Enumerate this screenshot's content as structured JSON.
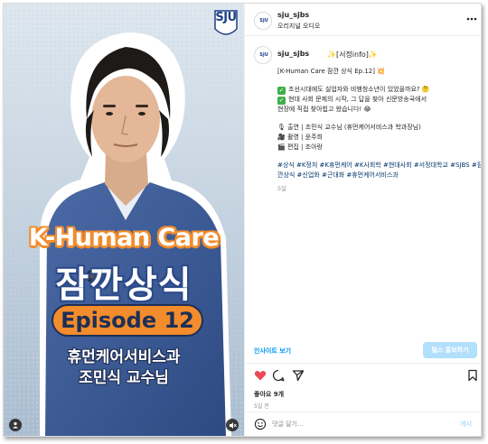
{
  "media": {
    "brand_logo": "SJU",
    "title_en": "K-Human Care",
    "title_ko": "잠깐상식",
    "episode": "Episode 12",
    "subtitle_1": "휴먼케어서비스과",
    "subtitle_2": "조민식 교수님",
    "icons": {
      "tagged_user": "user-tag-icon",
      "audio": "mute-icon"
    }
  },
  "header": {
    "username": "sju_sjbs",
    "subtitle": "오리지널 오디오",
    "more": "more-icon"
  },
  "caption": {
    "username": "sju_sjbs",
    "tag": "✨[서정info]✨",
    "title": "[K-Human Care 잠깐 상식 Ep.12] 💥",
    "item1": "조선시대에도 실업자와 비행청소년이 있었을까요? 🤔",
    "item2": "현대 사회 문제의 시작, 그 답을 찾아 신문방송국에서",
    "item2b": "현장에 직접 찾아힙고 왔습니다! 😂",
    "credit1": "🎙 출연 | 조민식 교수님 (휴먼케어서비스과 학과장님)",
    "credit2": "🎥 촬영 | 윤주희",
    "credit3": "🎬 편집 | 조아랑",
    "hashtags1": "#상식 #K정처 #K휴먼케어 #K사회학 #현대사회 #서정대학교 #SJBS #잠",
    "hashtags2": "깐상식 #신업화 #근대화 #휴먼케어서비스과",
    "age": "5일"
  },
  "actions": {
    "insight": "인사이트 보기",
    "boost": "릴스 홍보하기",
    "likes": "좋아요 9개",
    "time": "5일 전",
    "comment_placeholder": "댓글 달기...",
    "post": "게시"
  },
  "colors": {
    "accent_blue": "#0095f6",
    "like_red": "#ed4956",
    "boost_disabled": "#b2dffc",
    "episode_orange": "#f28c2c",
    "shirt_blue": "#3f5f9a"
  }
}
